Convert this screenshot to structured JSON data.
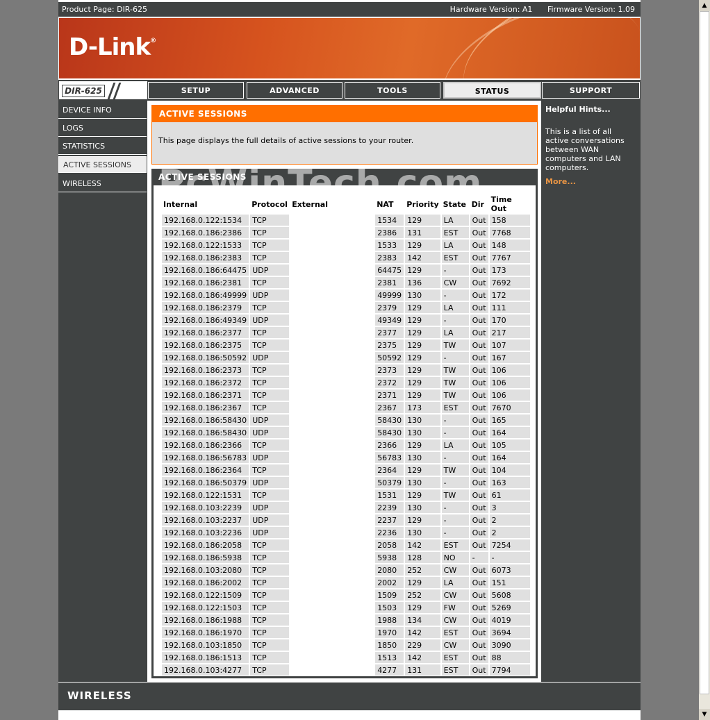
{
  "topbar": {
    "product": "Product Page: DIR-625",
    "hardware": "Hardware Version: A1",
    "firmware": "Firmware Version: 1.09"
  },
  "brand": {
    "logo": "D-Link",
    "model": "DIR-625",
    "footer": "WIRELESS"
  },
  "nav": [
    "SETUP",
    "ADVANCED",
    "TOOLS",
    "STATUS",
    "SUPPORT"
  ],
  "sidebar": [
    "DEVICE INFO",
    "LOGS",
    "STATISTICS",
    "ACTIVE SESSIONS",
    "WIRELESS"
  ],
  "intro": {
    "title": "ACTIVE SESSIONS",
    "text": "This page displays the full details of active sessions to your router."
  },
  "sessions": {
    "title": "ACTIVE SESSIONS",
    "headers": [
      "Internal",
      "Protocol",
      "External",
      "NAT",
      "Priority",
      "State",
      "Dir",
      "Time Out"
    ],
    "rows": [
      [
        "192.168.0.122:1534",
        "TCP",
        "",
        "1534",
        "129",
        "LA",
        "Out",
        "158"
      ],
      [
        "192.168.0.186:2386",
        "TCP",
        "",
        "2386",
        "131",
        "EST",
        "Out",
        "7768"
      ],
      [
        "192.168.0.122:1533",
        "TCP",
        "",
        "1533",
        "129",
        "LA",
        "Out",
        "148"
      ],
      [
        "192.168.0.186:2383",
        "TCP",
        "",
        "2383",
        "142",
        "EST",
        "Out",
        "7767"
      ],
      [
        "192.168.0.186:64475",
        "UDP",
        "",
        "64475",
        "129",
        "-",
        "Out",
        "173"
      ],
      [
        "192.168.0.186:2381",
        "TCP",
        "",
        "2381",
        "136",
        "CW",
        "Out",
        "7692"
      ],
      [
        "192.168.0.186:49999",
        "UDP",
        "",
        "49999",
        "130",
        "-",
        "Out",
        "172"
      ],
      [
        "192.168.0.186:2379",
        "TCP",
        "",
        "2379",
        "129",
        "LA",
        "Out",
        "111"
      ],
      [
        "192.168.0.186:49349",
        "UDP",
        "",
        "49349",
        "129",
        "-",
        "Out",
        "170"
      ],
      [
        "192.168.0.186:2377",
        "TCP",
        "",
        "2377",
        "129",
        "LA",
        "Out",
        "217"
      ],
      [
        "192.168.0.186:2375",
        "TCP",
        "",
        "2375",
        "129",
        "TW",
        "Out",
        "107"
      ],
      [
        "192.168.0.186:50592",
        "UDP",
        "",
        "50592",
        "129",
        "-",
        "Out",
        "167"
      ],
      [
        "192.168.0.186:2373",
        "TCP",
        "",
        "2373",
        "129",
        "TW",
        "Out",
        "106"
      ],
      [
        "192.168.0.186:2372",
        "TCP",
        "",
        "2372",
        "129",
        "TW",
        "Out",
        "106"
      ],
      [
        "192.168.0.186:2371",
        "TCP",
        "",
        "2371",
        "129",
        "TW",
        "Out",
        "106"
      ],
      [
        "192.168.0.186:2367",
        "TCP",
        "",
        "2367",
        "173",
        "EST",
        "Out",
        "7670"
      ],
      [
        "192.168.0.186:58430",
        "UDP",
        "",
        "58430",
        "130",
        "-",
        "Out",
        "165"
      ],
      [
        "192.168.0.186:58430",
        "UDP",
        "",
        "58430",
        "130",
        "-",
        "Out",
        "164"
      ],
      [
        "192.168.0.186:2366",
        "TCP",
        "",
        "2366",
        "129",
        "LA",
        "Out",
        "105"
      ],
      [
        "192.168.0.186:56783",
        "UDP",
        "",
        "56783",
        "130",
        "-",
        "Out",
        "164"
      ],
      [
        "192.168.0.186:2364",
        "TCP",
        "",
        "2364",
        "129",
        "TW",
        "Out",
        "104"
      ],
      [
        "192.168.0.186:50379",
        "UDP",
        "",
        "50379",
        "130",
        "-",
        "Out",
        "163"
      ],
      [
        "192.168.0.122:1531",
        "TCP",
        "",
        "1531",
        "129",
        "TW",
        "Out",
        "61"
      ],
      [
        "192.168.0.103:2239",
        "UDP",
        "",
        "2239",
        "130",
        "-",
        "Out",
        "3"
      ],
      [
        "192.168.0.103:2237",
        "UDP",
        "",
        "2237",
        "129",
        "-",
        "Out",
        "2"
      ],
      [
        "192.168.0.103:2236",
        "UDP",
        "",
        "2236",
        "130",
        "-",
        "Out",
        "2"
      ],
      [
        "192.168.0.186:2058",
        "TCP",
        "",
        "2058",
        "142",
        "EST",
        "Out",
        "7254"
      ],
      [
        "192.168.0.186:5938",
        "TCP",
        "",
        "5938",
        "128",
        "NO",
        "-",
        "-"
      ],
      [
        "192.168.0.103:2080",
        "TCP",
        "",
        "2080",
        "252",
        "CW",
        "Out",
        "6073"
      ],
      [
        "192.168.0.186:2002",
        "TCP",
        "",
        "2002",
        "129",
        "LA",
        "Out",
        "151"
      ],
      [
        "192.168.0.122:1509",
        "TCP",
        "",
        "1509",
        "252",
        "CW",
        "Out",
        "5608"
      ],
      [
        "192.168.0.122:1503",
        "TCP",
        "",
        "1503",
        "129",
        "FW",
        "Out",
        "5269"
      ],
      [
        "192.168.0.186:1988",
        "TCP",
        "",
        "1988",
        "134",
        "CW",
        "Out",
        "4019"
      ],
      [
        "192.168.0.186:1970",
        "TCP",
        "",
        "1970",
        "142",
        "EST",
        "Out",
        "3694"
      ],
      [
        "192.168.0.103:1850",
        "TCP",
        "",
        "1850",
        "229",
        "CW",
        "Out",
        "3090"
      ],
      [
        "192.168.0.186:1513",
        "TCP",
        "",
        "1513",
        "142",
        "EST",
        "Out",
        "88"
      ],
      [
        "192.168.0.103:4277",
        "TCP",
        "",
        "4277",
        "131",
        "EST",
        "Out",
        "7794"
      ]
    ]
  },
  "hints": {
    "title": "Helpful Hints...",
    "text": "This is a list of all active conversations between WAN computers and LAN computers.",
    "more": "More..."
  },
  "watermark": "PcWinTech.com"
}
